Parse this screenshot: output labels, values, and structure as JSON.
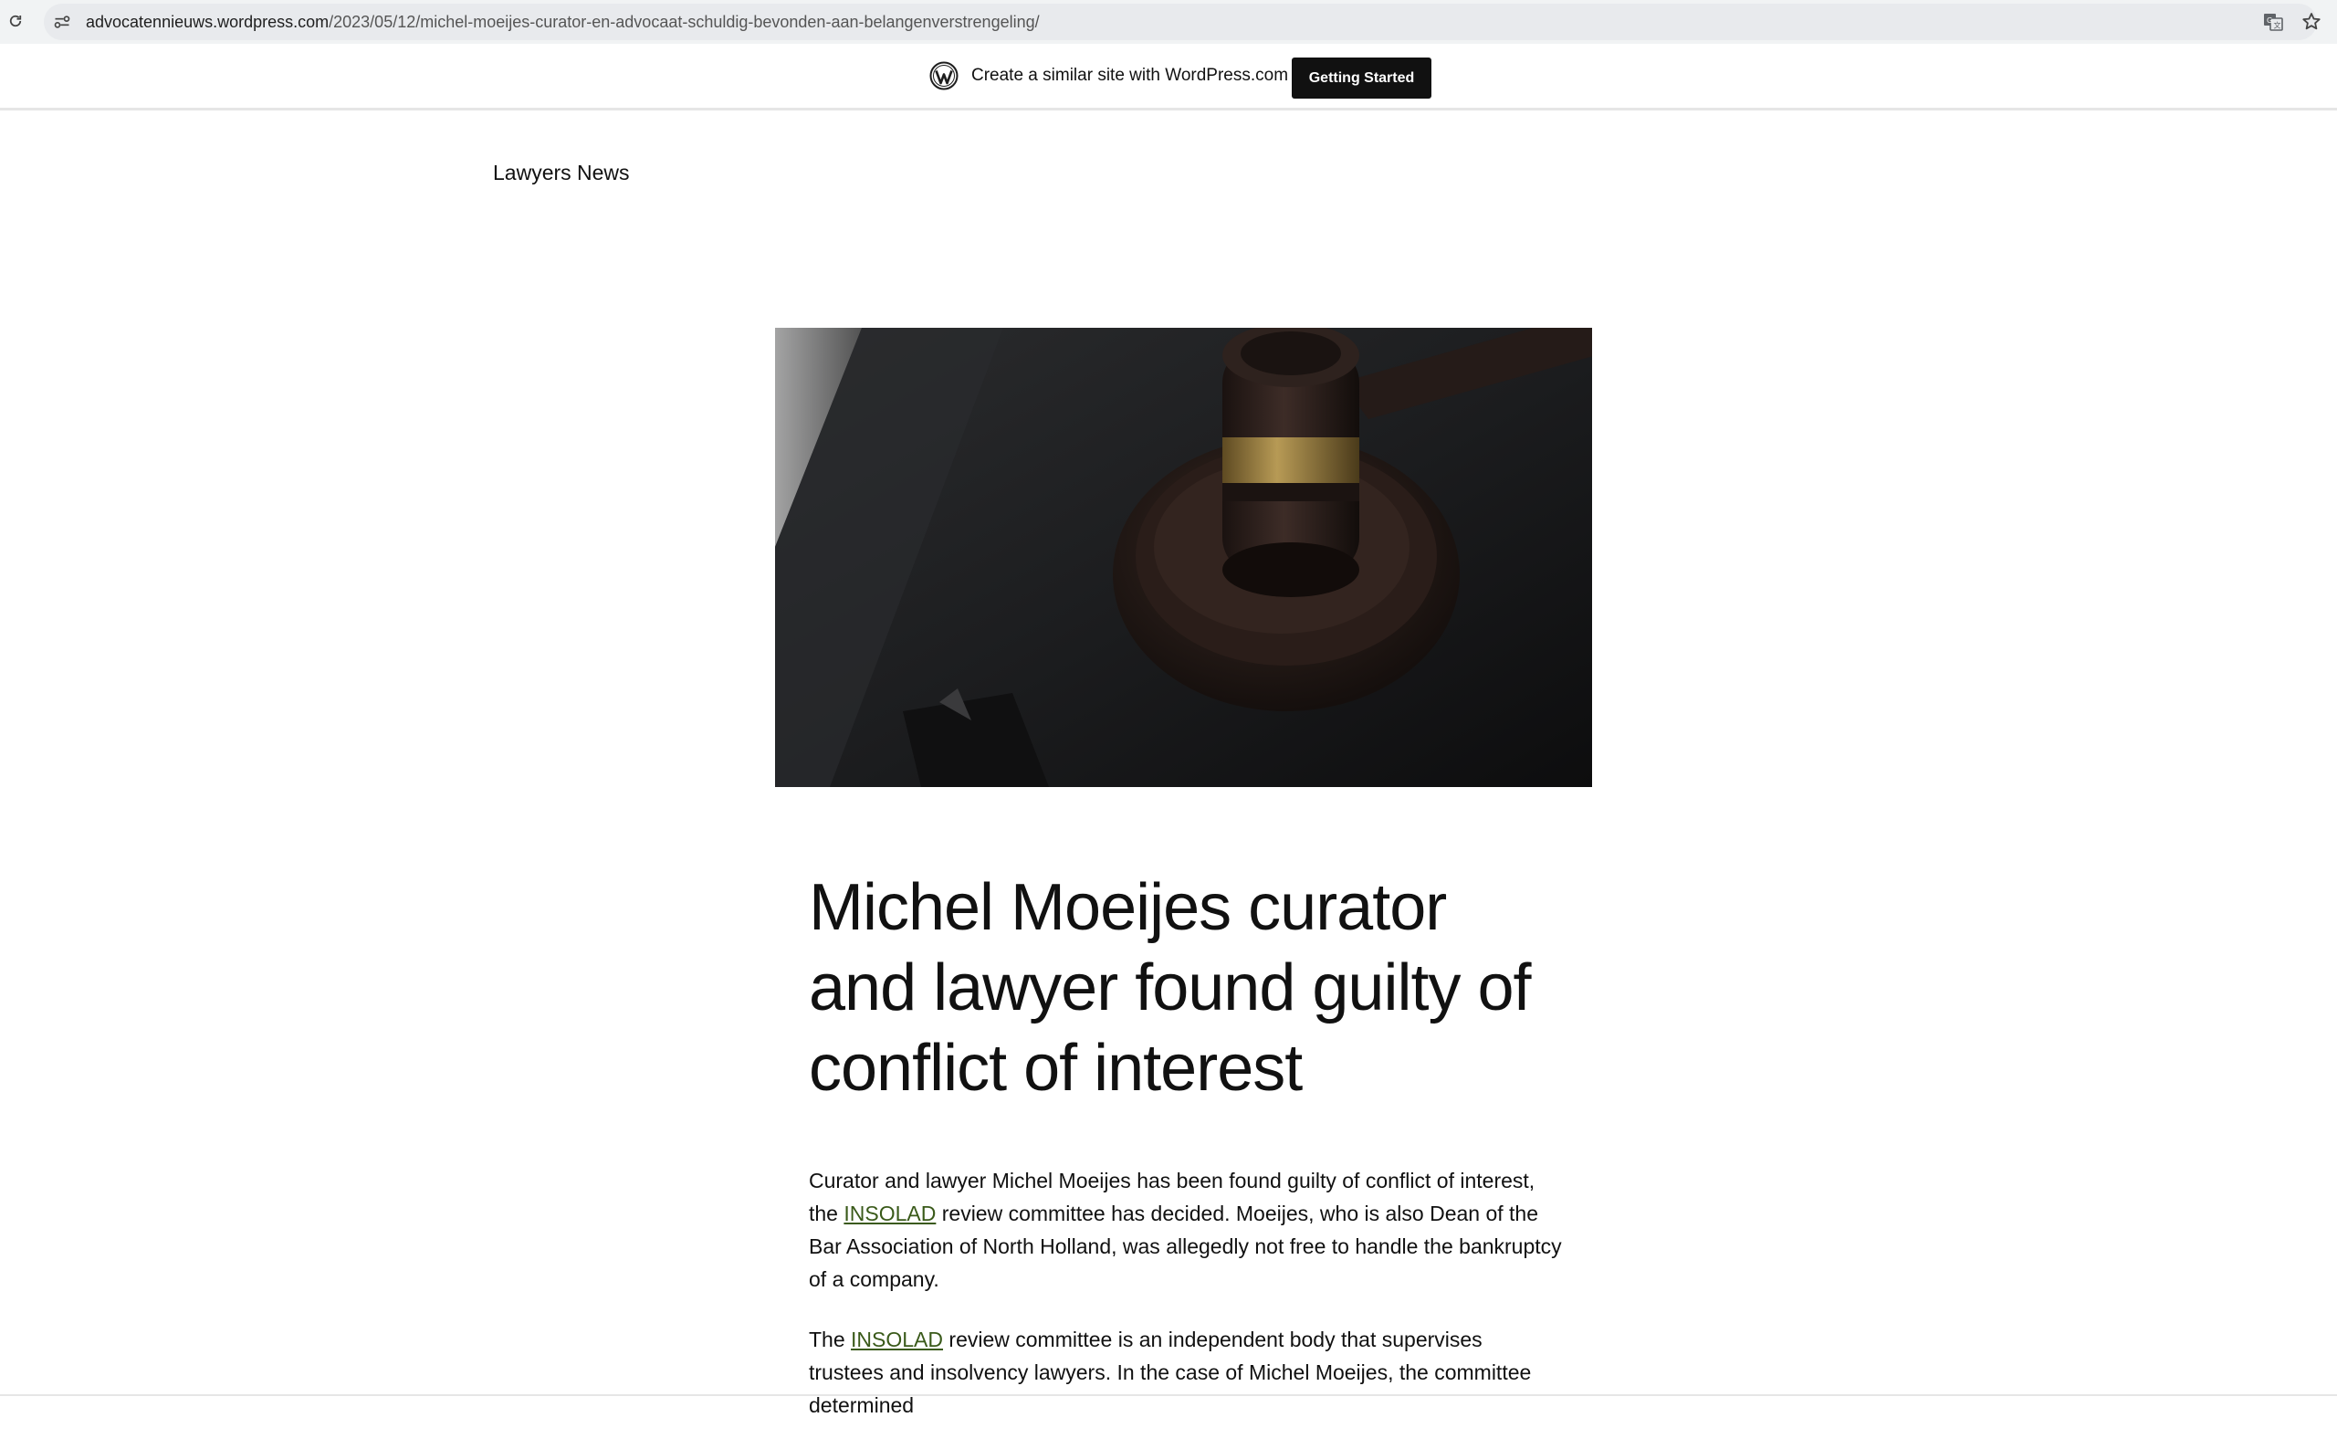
{
  "browser": {
    "url_host": "advocatennieuws.wordpress.com",
    "url_path": "/2023/05/12/michel-moeijes-curator-en-advocaat-schuldig-bevonden-aan-belangenverstrengeling/",
    "icons": [
      "reload-icon",
      "site-info-icon",
      "translate-icon",
      "star-icon"
    ]
  },
  "wp_banner": {
    "promo_text": "Create a similar site with WordPress.com",
    "cta_label": "Getting Started",
    "icon": "wordpress-logo-icon"
  },
  "site": {
    "title": "Lawyers News"
  },
  "post": {
    "title": "Michel Moeijes curator and lawyer found guilty of conflict of interest",
    "paragraph1": {
      "before_link": "Curator and lawyer Michel Moeijes has been found guilty of conflict of interest, the ",
      "link_text": "INSOLAD",
      "after_link": " review committee has decided. Moeijes, who is also Dean of the Bar Association of North Holland, was allegedly not free to handle the bankruptcy of a company."
    },
    "paragraph2": {
      "before_link": "The ",
      "link_text": "INSOLAD",
      "after_link": " review committee is an independent body that supervises trustees and insolvency lawyers. In the case of Michel Moeijes, the committee determined"
    }
  },
  "colors": {
    "link": "#3a5a1a",
    "cta_background": "#111111",
    "browser_bar": "#f1f3f4"
  }
}
